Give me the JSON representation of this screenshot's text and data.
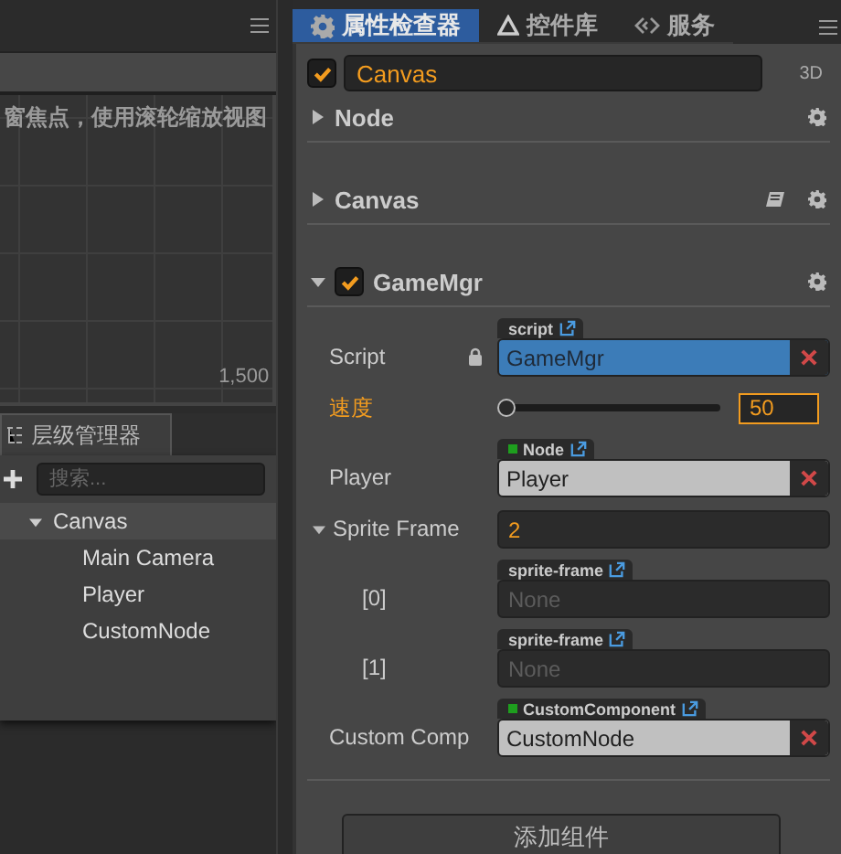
{
  "scene": {
    "hint": "窗焦点，使用滚轮缩放视图",
    "axis_label": "1,500"
  },
  "hierarchy": {
    "tab": "层级管理器",
    "search": {
      "placeholder": "搜索..."
    },
    "tree": [
      {
        "label": "Canvas",
        "expanded": true,
        "selected": true,
        "children": [
          {
            "label": "Main Camera",
            "selected": false
          },
          {
            "label": "Player",
            "selected": false
          },
          {
            "label": "CustomNode",
            "selected": false
          }
        ]
      }
    ]
  },
  "inspector": {
    "tabs": [
      {
        "label": "属性检查器",
        "selected": true,
        "kind": "gear"
      },
      {
        "label": "控件库",
        "selected": false,
        "kind": "triangle"
      },
      {
        "label": "服务",
        "selected": false,
        "kind": "service"
      }
    ],
    "node": {
      "active": true,
      "name": "Canvas",
      "mode": "3D"
    },
    "components": [
      {
        "name": "Node",
        "expanded": false
      },
      {
        "name": "Canvas",
        "expanded": false,
        "doc": true
      },
      {
        "name": "GameMgr",
        "expanded": true,
        "enabled": true,
        "properties": [
          {
            "kind": "script",
            "label": "Script",
            "locked": true,
            "tag": "script",
            "value": "GameMgr"
          },
          {
            "kind": "slider",
            "label": "速度",
            "highlighted": true,
            "level": 0,
            "value": "50"
          },
          {
            "kind": "ref",
            "label": "Player",
            "tag": "Node",
            "node_type": true,
            "value": "Player"
          },
          {
            "kind": "array",
            "label": "Sprite Frame",
            "expanded": true,
            "value": "2",
            "children": [
              {
                "kind": "empty",
                "label": "[0]",
                "tag": "sprite-frame",
                "placeholder": "None"
              },
              {
                "kind": "empty",
                "label": "[1]",
                "tag": "sprite-frame",
                "placeholder": "None"
              }
            ]
          },
          {
            "kind": "ref",
            "label": "Custom Comp",
            "tag": "CustomComponent",
            "node_type": true,
            "value": "CustomNode"
          }
        ]
      }
    ],
    "add_button": "添加组件"
  }
}
